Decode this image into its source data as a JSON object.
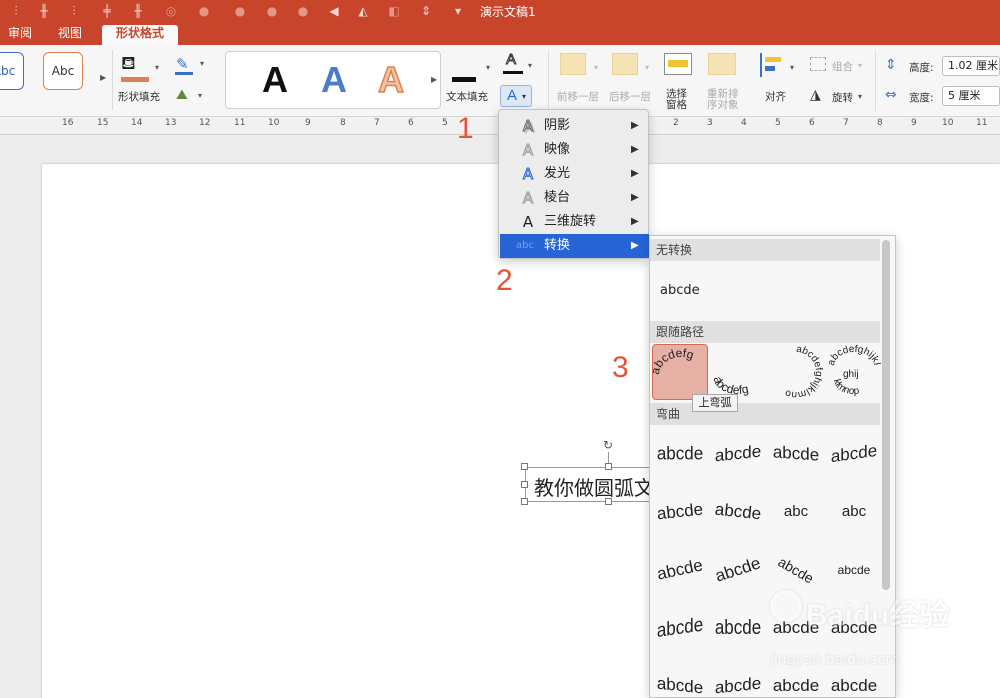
{
  "window": {
    "title": "演示文稿1"
  },
  "tabs": [
    {
      "label": "审阅"
    },
    {
      "label": "视图"
    },
    {
      "label": "形状格式",
      "active": true
    }
  ],
  "ribbon": {
    "shape_styles": [
      "Abc",
      "Abc"
    ],
    "shape_fill_label": "形状填充",
    "wordart_letter": "A",
    "text_fill_label": "文本填充",
    "text_outline_letter": "A",
    "text_effect_letter": "A",
    "bring_forward_label": "前移一层",
    "send_backward_label": "后移一层",
    "selection_pane_label": [
      "选择",
      "窗格"
    ],
    "reorder_label": [
      "重新排",
      "序对象"
    ],
    "align_label": "对齐",
    "group_label": "组合",
    "rotate_label": "旋转",
    "height_label": "高度:",
    "height_value": "1.02 厘米",
    "width_label": "宽度:",
    "width_value": "5 厘米"
  },
  "ruler": {
    "numbers_left": [
      "16",
      "15",
      "14",
      "13",
      "12",
      "11",
      "10",
      "9",
      "8",
      "7",
      "6",
      "5"
    ],
    "numbers_right": [
      "2",
      "3",
      "4",
      "5",
      "6",
      "7",
      "8",
      "9",
      "10",
      "11"
    ]
  },
  "slide": {
    "textbox_text": "教你做圆弧文"
  },
  "text_effects_menu": {
    "items": [
      {
        "label": "阴影",
        "icon": "shadow-a-icon"
      },
      {
        "label": "映像",
        "icon": "reflection-a-icon"
      },
      {
        "label": "发光",
        "icon": "glow-a-icon"
      },
      {
        "label": "棱台",
        "icon": "bevel-a-icon"
      },
      {
        "label": "三维旋转",
        "icon": "3d-rotation-a-icon"
      },
      {
        "label": "转换",
        "icon": "transform-abc-icon",
        "selected": true,
        "icon_text": "abc"
      }
    ]
  },
  "transform_submenu": {
    "no_transform_header": "无转换",
    "no_transform_sample": "abcde",
    "follow_path_header": "跟随路径",
    "follow_path_samples": [
      "abcdefg",
      "abcdefg",
      "abcdefghijklmno",
      "abcdefghijklmnop"
    ],
    "warp_header": "弯曲",
    "warp_samples": [
      "abcde",
      "abcde",
      "abcde",
      "abcde",
      "abcde",
      "abcde",
      "abc",
      "abc",
      "abcde",
      "abcde",
      "abcde",
      "abcde",
      "abcde",
      "abcde",
      "abcde",
      "abcde",
      "abcde",
      "abcde",
      "abcde",
      "abcde"
    ],
    "tooltip": "上弯弧"
  },
  "steps": [
    "1",
    "2",
    "3"
  ],
  "watermark": {
    "brand": "Baidu经验",
    "url": "jingyan.baidu.com"
  },
  "colors": {
    "accent": "#c8452b",
    "selection_blue": "#2765d6",
    "step_orange": "#e55336",
    "highlight": "#e7b0a4"
  }
}
